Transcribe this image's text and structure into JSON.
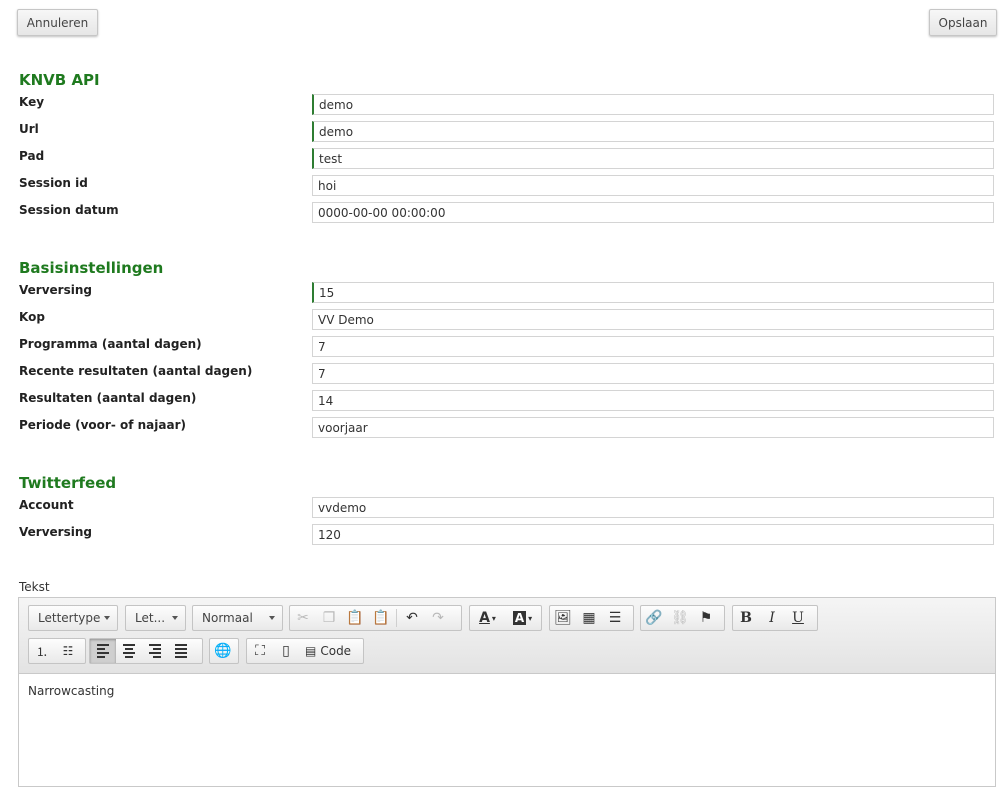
{
  "actions": {
    "cancel": "Annuleren",
    "save": "Opslaan"
  },
  "sections": {
    "knvb": {
      "title": "KNVB API",
      "fields": [
        {
          "label": "Key",
          "value": "demo",
          "required": true
        },
        {
          "label": "Url",
          "value": "demo",
          "required": true
        },
        {
          "label": "Pad",
          "value": "test",
          "required": true
        },
        {
          "label": "Session id",
          "value": "hoi",
          "required": false
        },
        {
          "label": "Session datum",
          "value": "0000-00-00 00:00:00",
          "required": false
        }
      ]
    },
    "basis": {
      "title": "Basisinstellingen",
      "fields": [
        {
          "label": "Verversing",
          "value": "15",
          "required": true
        },
        {
          "label": "Kop",
          "value": "VV Demo",
          "required": false
        },
        {
          "label": "Programma (aantal dagen)",
          "value": "7",
          "required": false
        },
        {
          "label": "Recente resultaten (aantal dagen)",
          "value": "7",
          "required": false
        },
        {
          "label": "Resultaten (aantal dagen)",
          "value": "14",
          "required": false
        },
        {
          "label": "Periode (voor- of najaar)",
          "value": "voorjaar",
          "required": false
        }
      ]
    },
    "twitter": {
      "title": "Twitterfeed",
      "fields": [
        {
          "label": "Account",
          "value": "vvdemo",
          "required": false
        },
        {
          "label": "Verversing",
          "value": "120",
          "required": false
        }
      ]
    }
  },
  "editor": {
    "label": "Tekst",
    "font_combo": "Lettertype",
    "size_combo": "Let...",
    "format_combo": "Normaal",
    "code_button": "Code",
    "content": "Narrowcasting"
  },
  "colors": {
    "section_title": "#1f7a1f",
    "required_marker": "#2e7d32"
  }
}
